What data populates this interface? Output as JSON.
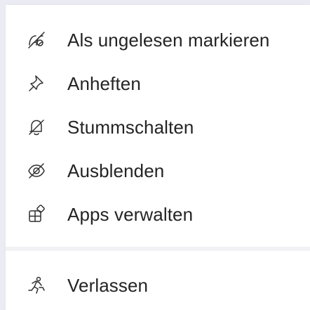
{
  "menu": {
    "items": [
      {
        "label": "Als ungelesen markieren",
        "icon": "mark-unread-icon"
      },
      {
        "label": "Anheften",
        "icon": "pin-icon"
      },
      {
        "label": "Stummschalten",
        "icon": "mute-bell-icon"
      },
      {
        "label": "Ausblenden",
        "icon": "hide-eye-icon"
      },
      {
        "label": "Apps verwalten",
        "icon": "manage-apps-icon"
      }
    ],
    "footer_item": {
      "label": "Verlassen",
      "icon": "leave-person-icon"
    }
  }
}
